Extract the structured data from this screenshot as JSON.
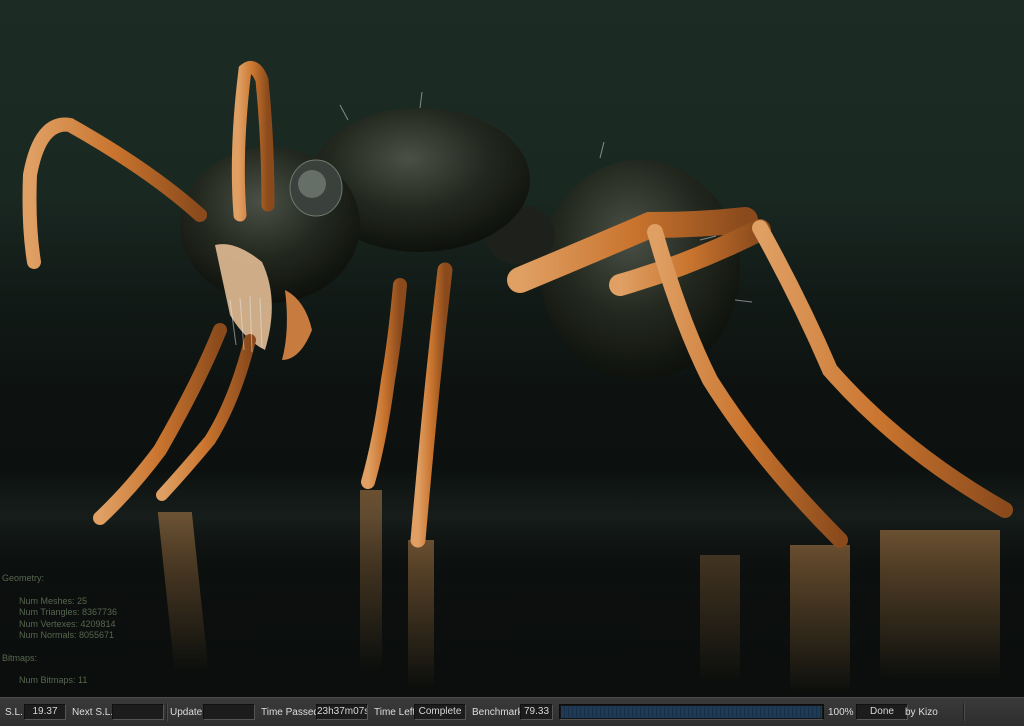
{
  "render_stats": {
    "geometry_heading": "Geometry:",
    "num_meshes": "Num Meshes: 25",
    "num_triangles": "Num Triangles: 8367736",
    "num_vertexes": "Num Vertexes: 4209814",
    "num_normals": "Num Normals: 8055671",
    "bitmaps_heading": "Bitmaps:",
    "num_bitmaps": "Num Bitmaps: 11"
  },
  "status_bar": {
    "sl_label": "S.L.",
    "sl_value": "19.37",
    "next_sl_label": "Next S.L.",
    "next_sl_value": "",
    "update_label": "Update",
    "update_value": "",
    "time_passed_label": "Time Passed",
    "time_passed_value": "23h37m07s",
    "time_left_label": "Time Left",
    "time_left_value": "Complete",
    "benchmark_label": "Benchmark",
    "benchmark_value": "79.33",
    "progress_fraction": 1.0,
    "progress_text": "100%",
    "state_value": "Done",
    "credit": "by Kizo"
  },
  "colors": {
    "leg": "#c9742e",
    "body": "#262a24",
    "progress": "#1e3a55"
  }
}
